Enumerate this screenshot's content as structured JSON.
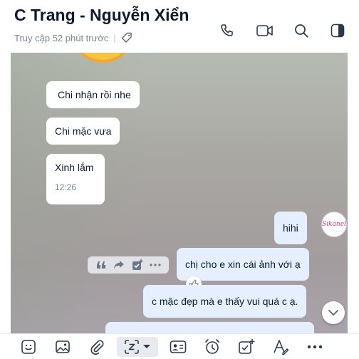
{
  "header": {
    "title": "C Trang - Nguyễn Xiển",
    "last_seen": "Truy cập 52 phút trước",
    "icons": [
      "phone-icon",
      "video-call-icon",
      "search-icon",
      "sidebar-toggle-icon"
    ]
  },
  "messages": [
    {
      "side": "in",
      "text": "Chi nhận rồi nhe"
    },
    {
      "side": "in",
      "text": "Chi mặc vưa"
    },
    {
      "side": "in",
      "text": "Xinh lắm",
      "time": "12:26"
    },
    {
      "side": "out",
      "text": "hihi"
    },
    {
      "side": "out",
      "text": "chị cho e xin cái ảnh với ạ"
    },
    {
      "side": "out",
      "text": "c mặc đẹp mà e thấy vui quá c ạ."
    }
  ],
  "avatar_text": "Sikanel",
  "message_actions": [
    "quote-icon",
    "forward-icon",
    "task-icon",
    "more-icon"
  ],
  "toolbar": [
    "sticker-icon",
    "image-icon",
    "attach-icon",
    "screenshot-icon",
    "contact-card-icon",
    "reminder-icon",
    "todo-icon",
    "format-text-icon",
    "more-icon"
  ],
  "colors": {
    "outgoing_bubble": "#e5efff",
    "incoming_bubble": "#ffffff",
    "accent": "#0068ff"
  }
}
